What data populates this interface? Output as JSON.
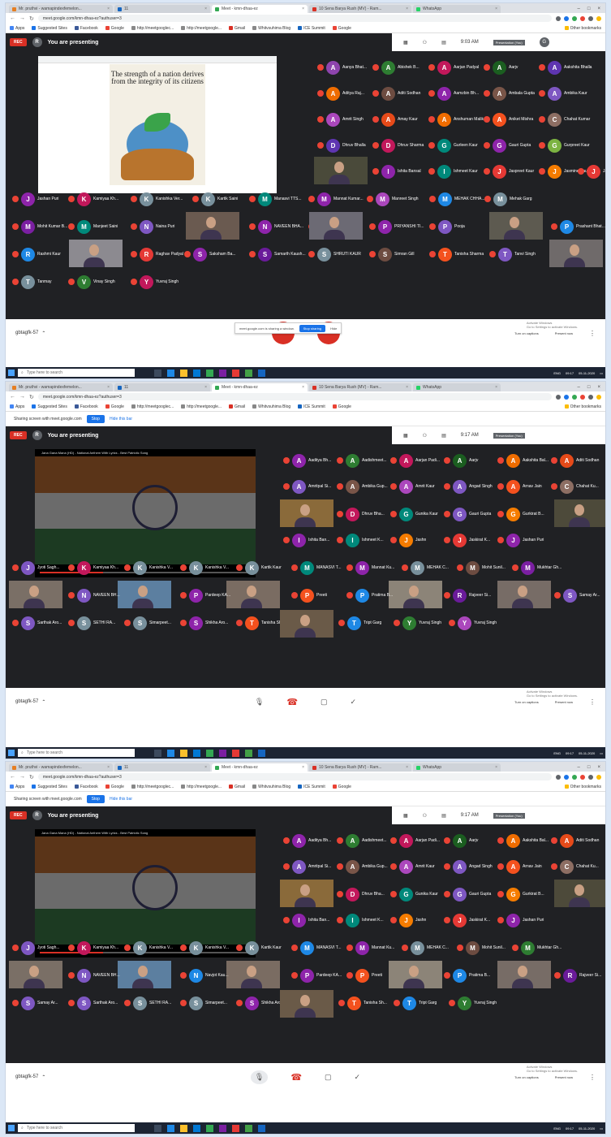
{
  "browser": {
    "tabs": [
      "Mr. pruthvi - wamapindexfemelon...",
      "11",
      "Meet - kmn-dhaa-ez",
      "10 Sena Barya Rush (MV) - Ram...",
      "WhatsApp"
    ],
    "url": "meet.google.com/kmn-dhaa-ez?authuser=3",
    "bookmarks": [
      "Apps",
      "Suggested Sites",
      "Facebook",
      "Google",
      "http://meetgooglec...",
      "http://meetgoogle...",
      "Gmail",
      "Whitvsuhima Blog",
      "ICE Summit",
      "Google",
      "Other bookmarks"
    ]
  },
  "screens": [
    {
      "header": {
        "rec": "REC",
        "presenter_initial": "R",
        "title": "You are presenting"
      },
      "topbar": {
        "time": "9:03 AM",
        "presentation_label": "Presentation (You)",
        "user_initial": "G"
      },
      "poster_quote": "The strength of a nation derives from the integrity of its citizens",
      "tiles": [
        {
          "i": "A",
          "n": "Aanya Bhat...",
          "c": "#8e44ad"
        },
        {
          "i": "A",
          "n": "Abishek B...",
          "c": "#2e7d32"
        },
        {
          "i": "A",
          "n": "Aarjan Padyal",
          "c": "#c2185b"
        },
        {
          "i": "A",
          "n": "Aarjv",
          "c": "#1b5e20"
        },
        {
          "i": "A",
          "n": "Aakshita Bhalla",
          "c": "#5e35b1"
        },
        {
          "i": "A",
          "n": "Aditya Raj...",
          "c": "#ef6c00"
        },
        {
          "i": "A",
          "n": "Aditi Sodhan",
          "c": "#6d4c41"
        },
        {
          "i": "A",
          "n": "Aamzbin Bh...",
          "c": "#8e24aa"
        },
        {
          "i": "A",
          "n": "Ambala Gupta",
          "c": "#795548"
        },
        {
          "i": "A",
          "n": "Ambika Kaur",
          "c": "#7e57c2"
        },
        {
          "i": "A",
          "n": "Amrit Singh",
          "c": "#ab47bc"
        },
        {
          "i": "A",
          "n": "Amay Kaur",
          "c": "#e64a19"
        },
        {
          "i": "A",
          "n": "Anshuman Malik",
          "c": "#ef6c00"
        },
        {
          "i": "A",
          "n": "Aniket Mishra",
          "c": "#f4511e"
        },
        {
          "i": "C",
          "n": "Chahat Kumar",
          "c": "#8d6e63"
        },
        {
          "i": "D",
          "n": "Dhruv Bhalla",
          "c": "#5e35b1"
        },
        {
          "i": "D",
          "n": "Dhruv Sharma",
          "c": "#c2185b"
        },
        {
          "i": "G",
          "n": "Gurleen Kaur",
          "c": "#00897b"
        },
        {
          "i": "G",
          "n": "Gauri Gupta",
          "c": "#8e24aa"
        },
        {
          "i": "G",
          "n": "Gurpreet Kaur",
          "c": "#7cb342"
        },
        {
          "i": "I",
          "n": "Ishita Bansal",
          "c": "#8e24aa"
        },
        {
          "i": "I",
          "n": "Ishmeet Kaur",
          "c": "#00897b"
        },
        {
          "i": "J",
          "n": "Jaspreet Kaur",
          "c": "#e53935"
        },
        {
          "i": "J",
          "n": "Jasmine Kaur",
          "c": "#f57c00"
        },
        {
          "i": "J",
          "n": "Jasmeet Kaur",
          "c": "#e53935"
        },
        {
          "i": "J",
          "n": "Jashan Puri",
          "c": "#8e24aa"
        },
        {
          "i": "K",
          "n": "Kamiyaa Kh...",
          "c": "#c2185b"
        },
        {
          "i": "K",
          "n": "Kanishka Ver...",
          "c": "#78909c"
        },
        {
          "i": "K",
          "n": "Kartik Saini",
          "c": "#78909c"
        },
        {
          "i": "M",
          "n": "Manasvi TTS...",
          "c": "#00897b"
        },
        {
          "i": "M",
          "n": "Mannat Kumar...",
          "c": "#8e24aa"
        },
        {
          "i": "M",
          "n": "Manreet Singh",
          "c": "#ab47bc"
        },
        {
          "i": "M",
          "n": "MEHAK CHHA...",
          "c": "#1e88e5"
        },
        {
          "i": "M",
          "n": "Mehak Garg",
          "c": "#78909c"
        },
        {
          "i": "M",
          "n": "Mohit Kumar B...",
          "c": "#7b1fa2"
        },
        {
          "i": "M",
          "n": "Manjeet Saini",
          "c": "#00897b"
        },
        {
          "i": "N",
          "n": "Naina Puri",
          "c": "#7e57c2"
        },
        {
          "i": "N",
          "n": "NAVEEN BHA...",
          "c": "#8e24aa"
        },
        {
          "i": "P",
          "n": "Pardeep Kaur",
          "c": "#2e7d32"
        },
        {
          "i": "P",
          "n": "PRIYANSHI TI...",
          "c": "#8e24aa"
        },
        {
          "i": "P",
          "n": "Pooja",
          "c": "#7e57c2"
        },
        {
          "i": "P",
          "n": "Prashant Bhat...",
          "c": "#1e88e5"
        },
        {
          "i": "R",
          "n": "Rashmi Kaur",
          "c": "#1e88e5"
        },
        {
          "i": "R",
          "n": "Raghav Padyal",
          "c": "#e53935"
        },
        {
          "i": "S",
          "n": "Saksham Ba...",
          "c": "#8e24aa"
        },
        {
          "i": "S",
          "n": "Samarth Kaush...",
          "c": "#6a1b9a"
        },
        {
          "i": "S",
          "n": "SHRUTI KAUR",
          "c": "#78909c"
        },
        {
          "i": "S",
          "n": "Simran Gill",
          "c": "#6d4c41"
        },
        {
          "i": "T",
          "n": "Tanisha Sharma",
          "c": "#f4511e"
        },
        {
          "i": "T",
          "n": "Tanvi Singh",
          "c": "#7e57c2"
        },
        {
          "i": "T",
          "n": "Tanmay",
          "c": "#78909c"
        },
        {
          "i": "V",
          "n": "Vinay Singh",
          "c": "#2e7d32"
        },
        {
          "i": "Y",
          "n": "Yuvraj Singh",
          "c": "#c2185b"
        }
      ],
      "ctrl": {
        "meeting_code": "gbtagfk-57",
        "captions": "Turn on captions",
        "present": "Present now",
        "activate": "Activate Windows",
        "activate_sub": "Go to Settings to activate Windows.",
        "sharing_text": "meet.google.com is sharing a window.",
        "stop_sharing": "Stop sharing",
        "hide": "Hide"
      }
    },
    {
      "infobar": {
        "text": "Sharing screen with meet.google.com",
        "stop": "Stop",
        "hide": "Hide this bar"
      },
      "header": {
        "rec": "REC",
        "presenter_initial": "R",
        "title": "You are presenting"
      },
      "topbar": {
        "time": "9:17 AM",
        "presentation_label": "Presentation (You)"
      },
      "video_title": "Jana Gana Mana (HD) - National Anthem With Lyrics - Best Patriotic Song",
      "video_presenter": "Raman Padyal",
      "tiles": [
        {
          "i": "A",
          "n": "Aaditya Bh...",
          "c": "#8e24aa"
        },
        {
          "i": "A",
          "n": "Aadishmeet...",
          "c": "#2e7d32"
        },
        {
          "i": "A",
          "n": "Aarjan Padi...",
          "c": "#c2185b"
        },
        {
          "i": "A",
          "n": "Aarjv",
          "c": "#1b5e20"
        },
        {
          "i": "A",
          "n": "Aakshita Bal...",
          "c": "#ef6c00"
        },
        {
          "i": "A",
          "n": "Aditi Sodhan",
          "c": "#e64a19"
        },
        {
          "i": "A",
          "n": "Amritpal Si...",
          "c": "#7e57c2"
        },
        {
          "i": "A",
          "n": "Ambika Gup...",
          "c": "#795548"
        },
        {
          "i": "A",
          "n": "Amrit Kaur",
          "c": "#ab47bc"
        },
        {
          "i": "A",
          "n": "Angad Singh",
          "c": "#7e57c2"
        },
        {
          "i": "A",
          "n": "Arnav Jain",
          "c": "#f4511e"
        },
        {
          "i": "C",
          "n": "Chahat Ku...",
          "c": "#8d6e63"
        },
        {
          "i": "D",
          "n": "Dhruv Bha...",
          "c": "#c2185b"
        },
        {
          "i": "G",
          "n": "Gunika Kaur",
          "c": "#00897b"
        },
        {
          "i": "G",
          "n": "Gauri Gupta",
          "c": "#7e57c2"
        },
        {
          "i": "G",
          "n": "Gurkirat B...",
          "c": "#f57c00"
        },
        {
          "i": "I",
          "n": "Ishita Ban...",
          "c": "#8e24aa"
        },
        {
          "i": "I",
          "n": "Ishmeet K...",
          "c": "#00897b"
        },
        {
          "i": "J",
          "n": "Jashn",
          "c": "#f57c00"
        },
        {
          "i": "J",
          "n": "Jaskirat K...",
          "c": "#e53935"
        },
        {
          "i": "J",
          "n": "Jashan Puri",
          "c": "#8e24aa"
        },
        {
          "i": "J",
          "n": "Jyoti Sagh...",
          "c": "#7e57c2"
        },
        {
          "i": "K",
          "n": "Kamiyaa Kh...",
          "c": "#c2185b"
        },
        {
          "i": "K",
          "n": "Kanishka V...",
          "c": "#78909c"
        },
        {
          "i": "K",
          "n": "Kanishka V...",
          "c": "#78909c"
        },
        {
          "i": "K",
          "n": "Kartik Kaur",
          "c": "#78909c"
        },
        {
          "i": "M",
          "n": "MANASVI T...",
          "c": "#00897b"
        },
        {
          "i": "M",
          "n": "Mannat Ku...",
          "c": "#8e24aa"
        },
        {
          "i": "M",
          "n": "MEHAK C...",
          "c": "#78909c"
        },
        {
          "i": "M",
          "n": "Mohit Sunil...",
          "c": "#6d4c41"
        },
        {
          "i": "M",
          "n": "Mukhtar Gh...",
          "c": "#7b1fa2"
        },
        {
          "i": "N",
          "n": "NAVEEN BH...",
          "c": "#7e57c2"
        },
        {
          "i": "P",
          "n": "Pardeep KA...",
          "c": "#8e24aa"
        },
        {
          "i": "P",
          "n": "Preeti",
          "c": "#f4511e"
        },
        {
          "i": "P",
          "n": "Pratima B...",
          "c": "#1e88e5"
        },
        {
          "i": "R",
          "n": "Rajveer Si...",
          "c": "#6a1b9a"
        },
        {
          "i": "S",
          "n": "Samay Ar...",
          "c": "#7e57c2"
        },
        {
          "i": "S",
          "n": "Sarthak Aro...",
          "c": "#7e57c2"
        },
        {
          "i": "S",
          "n": "SETHI RA...",
          "c": "#78909c"
        },
        {
          "i": "S",
          "n": "Simarpeet...",
          "c": "#78909c"
        },
        {
          "i": "S",
          "n": "Shikha Aro...",
          "c": "#8e24aa"
        },
        {
          "i": "T",
          "n": "Tanisha Sh...",
          "c": "#f4511e"
        },
        {
          "i": "T",
          "n": "Tript Garg",
          "c": "#1e88e5"
        },
        {
          "i": "Y",
          "n": "Yuvraj Singh",
          "c": "#2e7d32"
        },
        {
          "i": "Y",
          "n": "Yuvraj Singh",
          "c": "#ab47bc"
        }
      ],
      "ctrl": {
        "meeting_code": "gbtagfk-57",
        "captions": "Turn on captions",
        "present": "Present now",
        "activate": "Activate Windows",
        "activate_sub": "Go to Settings to activate Windows."
      }
    },
    {
      "infobar": {
        "text": "Sharing screen with meet.google.com",
        "stop": "Stop",
        "hide": "Hide this bar"
      },
      "header": {
        "rec": "REC",
        "presenter_initial": "R",
        "title": "You are presenting"
      },
      "topbar": {
        "time": "9:17 AM",
        "presentation_label": "Presentation (You)"
      },
      "video_title": "Jana Gana Mana (HD) - National Anthem With Lyrics - Best Patriotic Song",
      "video_presenter": "Raman Padyal",
      "tiles": [
        {
          "i": "A",
          "n": "Aaditya Bh...",
          "c": "#8e24aa"
        },
        {
          "i": "A",
          "n": "Aadishmeet...",
          "c": "#2e7d32"
        },
        {
          "i": "A",
          "n": "Aarjan Padi...",
          "c": "#c2185b"
        },
        {
          "i": "A",
          "n": "Aarjv",
          "c": "#1b5e20"
        },
        {
          "i": "A",
          "n": "Aakshita Bal...",
          "c": "#ef6c00"
        },
        {
          "i": "A",
          "n": "Aditi Sodhan",
          "c": "#e64a19"
        },
        {
          "i": "A",
          "n": "Amritpal Si...",
          "c": "#7e57c2"
        },
        {
          "i": "A",
          "n": "Ambika Gup...",
          "c": "#795548"
        },
        {
          "i": "A",
          "n": "Amrit Kaur",
          "c": "#ab47bc"
        },
        {
          "i": "A",
          "n": "Angad Singh",
          "c": "#7e57c2"
        },
        {
          "i": "A",
          "n": "Arnav Jain",
          "c": "#f4511e"
        },
        {
          "i": "C",
          "n": "Chahat Ku...",
          "c": "#8d6e63"
        },
        {
          "i": "D",
          "n": "Dhruv Bha...",
          "c": "#c2185b"
        },
        {
          "i": "G",
          "n": "Gunika Kaur",
          "c": "#00897b"
        },
        {
          "i": "G",
          "n": "Gauri Gupta",
          "c": "#7e57c2"
        },
        {
          "i": "G",
          "n": "Gurkirat B...",
          "c": "#f57c00"
        },
        {
          "i": "I",
          "n": "Ishita Ban...",
          "c": "#8e24aa"
        },
        {
          "i": "I",
          "n": "Ishmeet K...",
          "c": "#00897b"
        },
        {
          "i": "J",
          "n": "Jashn",
          "c": "#f57c00"
        },
        {
          "i": "J",
          "n": "Jaskirat K...",
          "c": "#e53935"
        },
        {
          "i": "J",
          "n": "Jashan Puri",
          "c": "#8e24aa"
        },
        {
          "i": "J",
          "n": "Jyoti Sagh...",
          "c": "#7e57c2"
        },
        {
          "i": "K",
          "n": "Kamiyaa Kh...",
          "c": "#c2185b"
        },
        {
          "i": "K",
          "n": "Kanishka V...",
          "c": "#78909c"
        },
        {
          "i": "K",
          "n": "Kanishka V...",
          "c": "#78909c"
        },
        {
          "i": "K",
          "n": "Kartik Kaur",
          "c": "#78909c"
        },
        {
          "i": "M",
          "n": "MANASVI T...",
          "c": "#1e88e5"
        },
        {
          "i": "M",
          "n": "Mannat Ku...",
          "c": "#8e24aa"
        },
        {
          "i": "M",
          "n": "MEHAK C...",
          "c": "#78909c"
        },
        {
          "i": "M",
          "n": "Mohit Sunil...",
          "c": "#6d4c41"
        },
        {
          "i": "M",
          "n": "Mukhtar Gh...",
          "c": "#2e7d32"
        },
        {
          "i": "N",
          "n": "NAVEEN BH...",
          "c": "#7e57c2"
        },
        {
          "i": "N",
          "n": "Navjot Kau...",
          "c": "#1e88e5"
        },
        {
          "i": "P",
          "n": "Pardeep KA...",
          "c": "#8e24aa"
        },
        {
          "i": "P",
          "n": "Preeti",
          "c": "#f4511e"
        },
        {
          "i": "P",
          "n": "Pratima B...",
          "c": "#1e88e5"
        },
        {
          "i": "R",
          "n": "Rajveer Si...",
          "c": "#6a1b9a"
        },
        {
          "i": "S",
          "n": "Samay Ar...",
          "c": "#7e57c2"
        },
        {
          "i": "S",
          "n": "Sarthak Aro...",
          "c": "#7e57c2"
        },
        {
          "i": "S",
          "n": "SETHI RA...",
          "c": "#78909c"
        },
        {
          "i": "S",
          "n": "Simarpeet...",
          "c": "#78909c"
        },
        {
          "i": "S",
          "n": "Shikha Aro...",
          "c": "#8e24aa"
        },
        {
          "i": "T",
          "n": "Tanisha Sh...",
          "c": "#f4511e"
        },
        {
          "i": "T",
          "n": "Tript Garg",
          "c": "#1e88e5"
        },
        {
          "i": "Y",
          "n": "Yuvraj Singh",
          "c": "#2e7d32"
        },
        {
          "i": "Y",
          "n": "Yuvraj Singh",
          "c": "#ab47bc"
        }
      ],
      "ctrl": {
        "meeting_code": "gbtagfk-57",
        "captions": "Turn on captions",
        "present": "Present now",
        "activate": "Activate Windows",
        "activate_sub": "Go to Settings to activate Windows."
      }
    }
  ],
  "taskbar": {
    "search_placeholder": "Type here to search",
    "time": "09:17",
    "date": "05-11-2020",
    "lang": "ENG"
  }
}
